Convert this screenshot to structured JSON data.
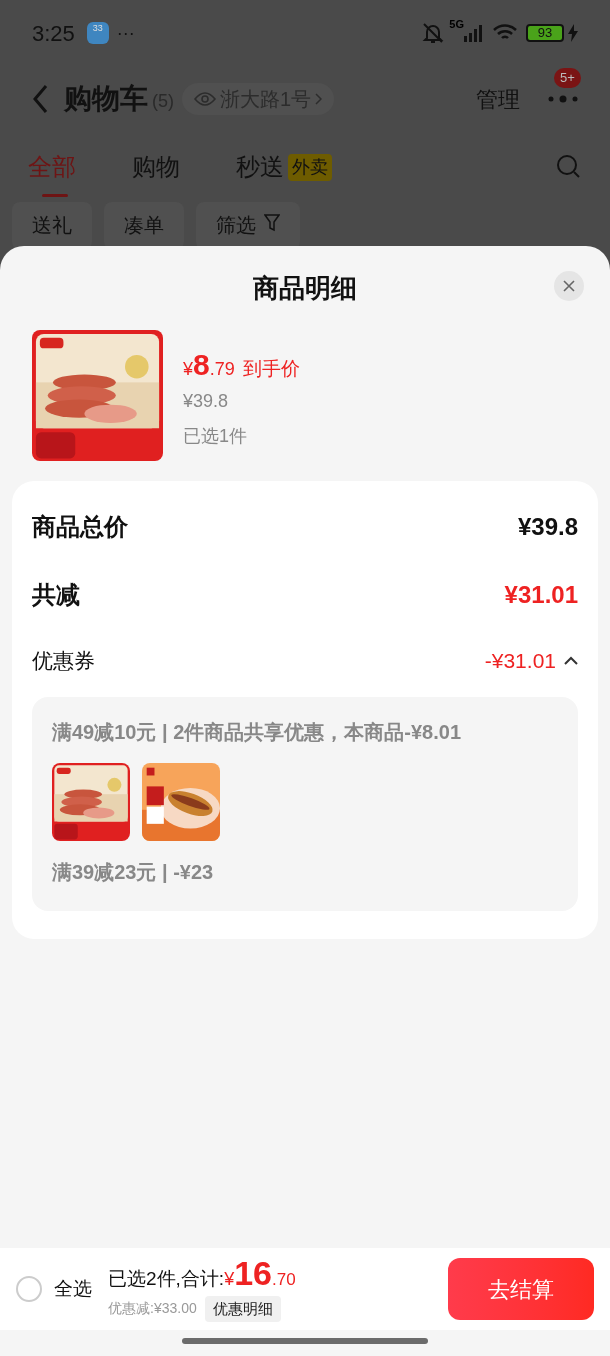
{
  "status_bar": {
    "time": "3:25",
    "weather": "33",
    "more": "···",
    "network": "5G",
    "battery": "93"
  },
  "header": {
    "title": "购物车",
    "count": "(5)",
    "address": "浙大路1号",
    "manage": "管理",
    "badge": "5+"
  },
  "tabs": [
    {
      "label": "全部",
      "selected": true
    },
    {
      "label": "购物",
      "selected": false
    },
    {
      "label": "秒送",
      "selected": false,
      "tag": "外卖"
    }
  ],
  "chips": [
    {
      "label": "送礼",
      "kind": "plain"
    },
    {
      "label": "凑单",
      "kind": "plain"
    },
    {
      "label": "筛选",
      "kind": "filter"
    }
  ],
  "sheet": {
    "title": "商品明细",
    "product": {
      "currency": "¥",
      "price_int": "8",
      "price_dec": ".79",
      "price_label": "到手价",
      "original": "¥39.8",
      "selected_count": "已选1件"
    },
    "rows": [
      {
        "label": "商品总价",
        "value": "¥39.8",
        "kind": "total"
      },
      {
        "label": "共减",
        "value": "¥31.01",
        "kind": "discount"
      }
    ],
    "coupon": {
      "label": "优惠券",
      "value": "-¥31.01",
      "expanded": true
    },
    "promos": [
      {
        "text": "满49减10元 | 2件商品共享优惠，本商品-¥8.01",
        "thumbnails": [
          {
            "kind": "sausage"
          },
          {
            "kind": "hotdog"
          }
        ]
      },
      {
        "text": "满39减23元 | -¥23"
      }
    ]
  },
  "footer": {
    "select_all": {
      "label": "全选",
      "checked": false
    },
    "summary": "已选2件,合计:",
    "currency": "¥",
    "total_int": "16",
    "total_dec": ".70",
    "saving": "优惠减:¥33.00",
    "detail_button": "优惠明细",
    "checkout": "去结算"
  }
}
